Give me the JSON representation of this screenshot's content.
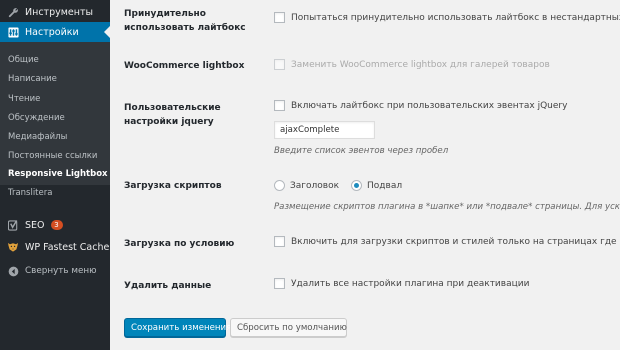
{
  "sidebar": {
    "tools": {
      "label": "Инструменты",
      "icon": "wrench-icon"
    },
    "settings": {
      "label": "Настройки",
      "icon": "settings-sliders-icon"
    },
    "submenu": [
      "Общие",
      "Написание",
      "Чтение",
      "Обсуждение",
      "Медиафайлы",
      "Постоянные ссылки",
      "Responsive Lightbox",
      "Translitera"
    ],
    "current_submenu": "Responsive Lightbox",
    "seo": {
      "label": "SEO",
      "badge": "3",
      "icon": "yoast-seo-icon"
    },
    "wpfc": {
      "label": "WP Fastest Cache",
      "icon": "cheetah-icon"
    },
    "collapse": {
      "label": "Свернуть меню",
      "icon": "collapse-arrow-icon"
    }
  },
  "settings": {
    "force_lightbox": {
      "label": "Принудительно использовать лайтбокс",
      "checkbox_label": "Попытаться принудительно использовать лайтбокс в нестандартных альтер"
    },
    "woocommerce": {
      "label": "WooCommerce lightbox",
      "checkbox_label": "Заменить WooCommerce lightbox для галерей товаров"
    },
    "custom_events": {
      "label": "Пользовательские настройки jquery",
      "checkbox_label": "Включать лайтбокс при пользовательских эвентах jQuery",
      "input_value": "ajaxComplete",
      "description": "Введите список эвентов через пробел"
    },
    "script_loading": {
      "label": "Загрузка скриптов",
      "options": [
        "Заголовок",
        "Подвал"
      ],
      "selected": "Подвал",
      "description": "Размещение скриптов плагина в *шапке* или *подвале* страницы. Для ускор"
    },
    "conditional_loading": {
      "label": "Загрузка по условию",
      "checkbox_label": "Включить для загрузки скриптов и стилей только на страницах где есть гале"
    },
    "delete_data": {
      "label": "Удалить данные",
      "checkbox_label": "Удалить все настройки плагина при деактивации"
    }
  },
  "buttons": {
    "save": "Сохранить изменения",
    "reset": "Сбросить по умолчанию"
  },
  "colors": {
    "sidebar_bg": "#23282d",
    "submenu_bg": "#32373c",
    "accent": "#0073aa",
    "primary_button": "#0085ba",
    "badge": "#d54e21",
    "page_bg": "#f1f1f1"
  }
}
